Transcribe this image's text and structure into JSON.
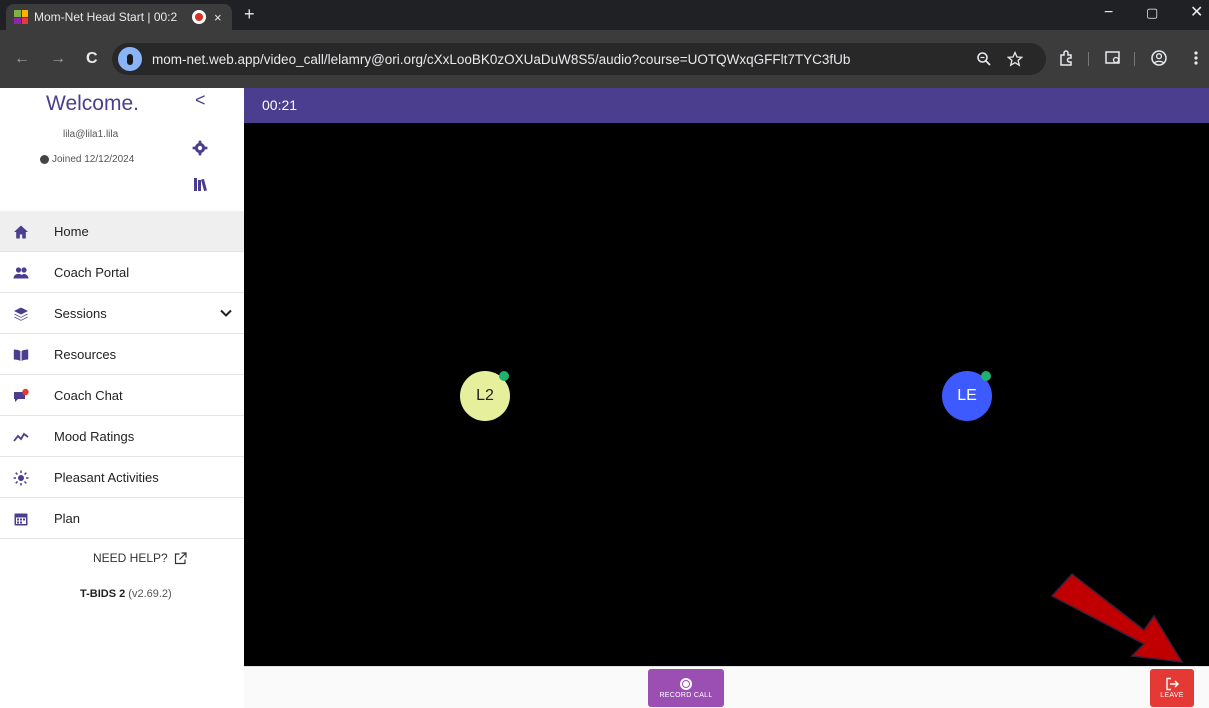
{
  "browser": {
    "tab_title": "Mom-Net Head Start | 00:2",
    "tab_close": "×",
    "new_tab": "+",
    "url": "mom-net.web.app/video_call/lelamry@ori.org/cXxLooBK0zOXUaDuW8S5/audio?course=UOTQWxqGFFlt7TYC3fUb",
    "nav": {
      "back": "←",
      "forward": "→",
      "reload": "C"
    },
    "window_controls": {
      "minimize": "−",
      "restore": "▢",
      "close": "✕"
    }
  },
  "sidebar": {
    "welcome": "Welcome.",
    "collapse": "<",
    "email": "lila@lila1.lila",
    "joined": "Joined 12/12/2024",
    "items": [
      {
        "label": "Home",
        "icon": "home-icon",
        "active": true
      },
      {
        "label": "Coach Portal",
        "icon": "users-icon"
      },
      {
        "label": "Sessions",
        "icon": "layers-icon"
      },
      {
        "label": "Resources",
        "icon": "book-icon"
      },
      {
        "label": "Coach Chat",
        "icon": "chat-icon"
      },
      {
        "label": "Mood Ratings",
        "icon": "chart-line-icon"
      },
      {
        "label": "Pleasant Activities",
        "icon": "sun-icon"
      },
      {
        "label": "Plan",
        "icon": "calendar-icon"
      }
    ],
    "help": "NEED HELP?",
    "version_name": "T-BIDS 2",
    "version_number": "(v2.69.2)"
  },
  "call": {
    "timer": "00:21",
    "participants": [
      {
        "initials": "L2",
        "color": "#e6ef9c",
        "text_color": "#222222"
      },
      {
        "initials": "LE",
        "color": "#3d5afe",
        "text_color": "#ffffff"
      }
    ],
    "record_label": "RECORD CALL",
    "leave_label": "LEAVE"
  },
  "colors": {
    "accent": "#4b3e8e",
    "record": "#9b4fb2",
    "leave": "#e53935",
    "online": "#20b06f",
    "annotation_arrow": "#c00000"
  }
}
